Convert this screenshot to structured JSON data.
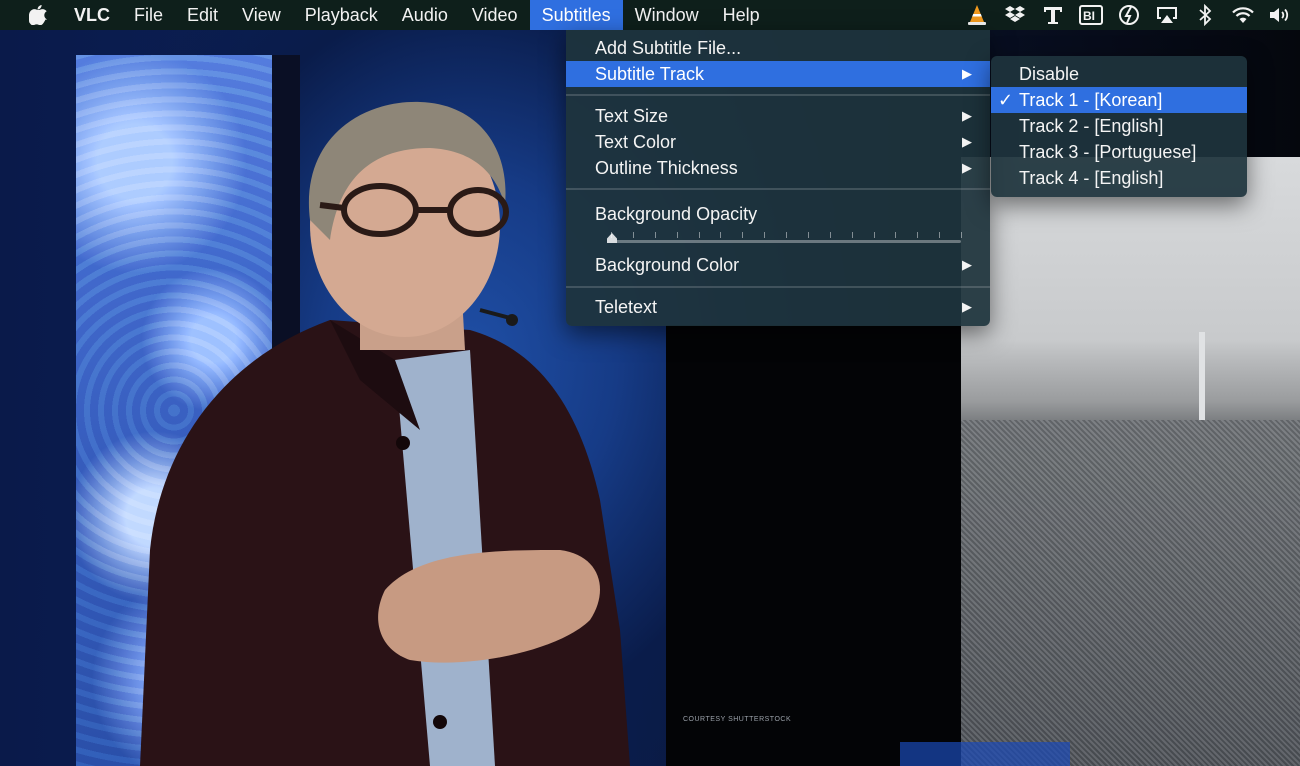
{
  "menubar": {
    "apple_icon": "apple-logo-icon",
    "items": [
      {
        "label": "VLC"
      },
      {
        "label": "File"
      },
      {
        "label": "Edit"
      },
      {
        "label": "View"
      },
      {
        "label": "Playback"
      },
      {
        "label": "Audio"
      },
      {
        "label": "Video"
      },
      {
        "label": "Subtitles"
      },
      {
        "label": "Window"
      },
      {
        "label": "Help"
      }
    ],
    "active_item": "Subtitles",
    "status_icons": [
      "vlc-cone-icon",
      "dropbox-icon",
      "text-tool-icon",
      "bi-icon",
      "sync-icon",
      "airplay-icon",
      "bluetooth-icon",
      "wifi-icon",
      "volume-icon"
    ]
  },
  "subtitles_menu": {
    "items": [
      {
        "label": "Add Subtitle File...",
        "submenu": false
      },
      {
        "label": "Subtitle Track",
        "submenu": true,
        "highlighted": true
      },
      {
        "label": "Text Size",
        "submenu": true
      },
      {
        "label": "Text Color",
        "submenu": true
      },
      {
        "label": "Outline Thickness",
        "submenu": true
      },
      {
        "label": "Background Opacity",
        "submenu": false
      },
      {
        "label": "Background Color",
        "submenu": true
      },
      {
        "label": "Teletext",
        "submenu": true
      }
    ],
    "background_opacity": 0.0
  },
  "subtitle_track_menu": {
    "items": [
      {
        "label": "Disable",
        "checked": false
      },
      {
        "label": "Track 1 - [Korean]",
        "checked": true
      },
      {
        "label": "Track 2 - [English]",
        "checked": false
      },
      {
        "label": "Track 3 - [Portuguese]",
        "checked": false
      },
      {
        "label": "Track 4 - [English]",
        "checked": false
      }
    ],
    "check_glyph": "✓"
  },
  "video": {
    "watermark": "COURTESY SHUTTERSTOCK"
  },
  "colors": {
    "menubar_bg": "#0e1f1b",
    "menu_bg": "#1e343c",
    "highlight": "#2f6fe0"
  }
}
